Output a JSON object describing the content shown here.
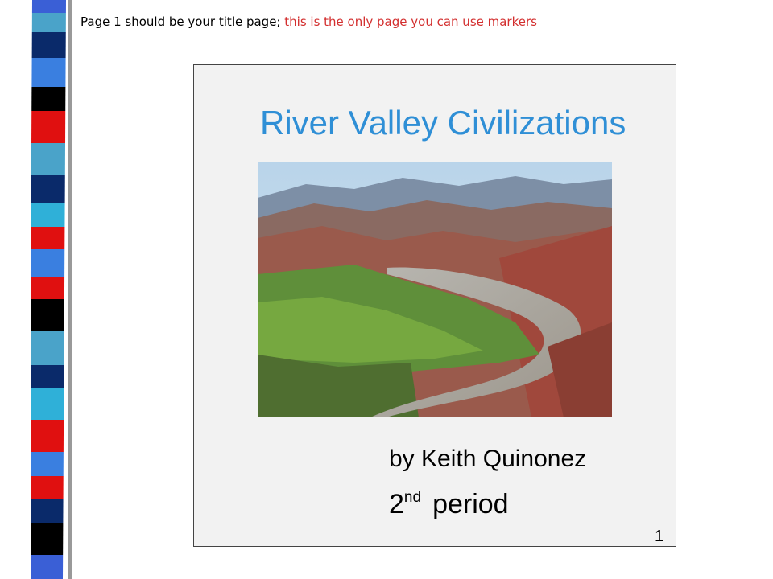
{
  "instruction": {
    "prefix": "Page 1 should be your title page;",
    "highlight": "this is the only page you can use markers"
  },
  "slide": {
    "title": "River Valley Civilizations",
    "byline": "by Keith Quinonez",
    "period_number": "2",
    "period_suffix": "nd",
    "period_word": "period",
    "page_number": "1"
  },
  "colors": {
    "title": "#2f8fd6",
    "highlight": "#d32f2f",
    "stripes": [
      "#000000",
      "#3a5fd6",
      "#0a2a6a",
      "#4aa3c9",
      "#e01010",
      "#2fb0d8"
    ]
  },
  "photo_icon": "river-valley-landscape"
}
